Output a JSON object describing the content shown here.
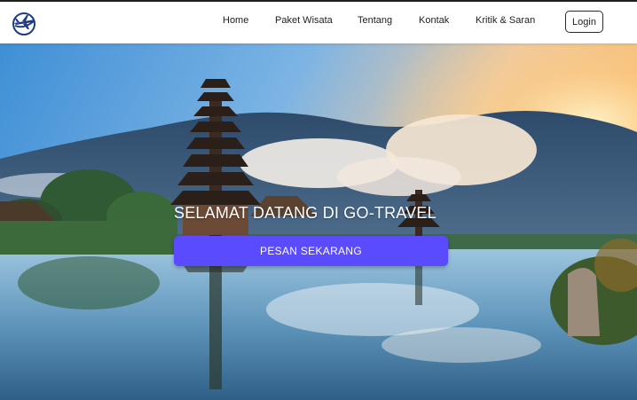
{
  "nav": {
    "logo_icon": "airplane-globe-icon",
    "links": [
      {
        "label": "Home"
      },
      {
        "label": "Paket Wisata"
      },
      {
        "label": "Tentang"
      },
      {
        "label": "Kontak"
      },
      {
        "label": "Kritik & Saran"
      }
    ],
    "login_label": "Login"
  },
  "hero": {
    "title": "SELAMAT DATANG DI GO-TRAVEL",
    "cta_label": "PESAN SEKARANG",
    "image": "lake-temple-pagoda-mountain-landscape"
  },
  "colors": {
    "accent": "#5a4bff",
    "logo_blue": "#1e3a8a"
  }
}
